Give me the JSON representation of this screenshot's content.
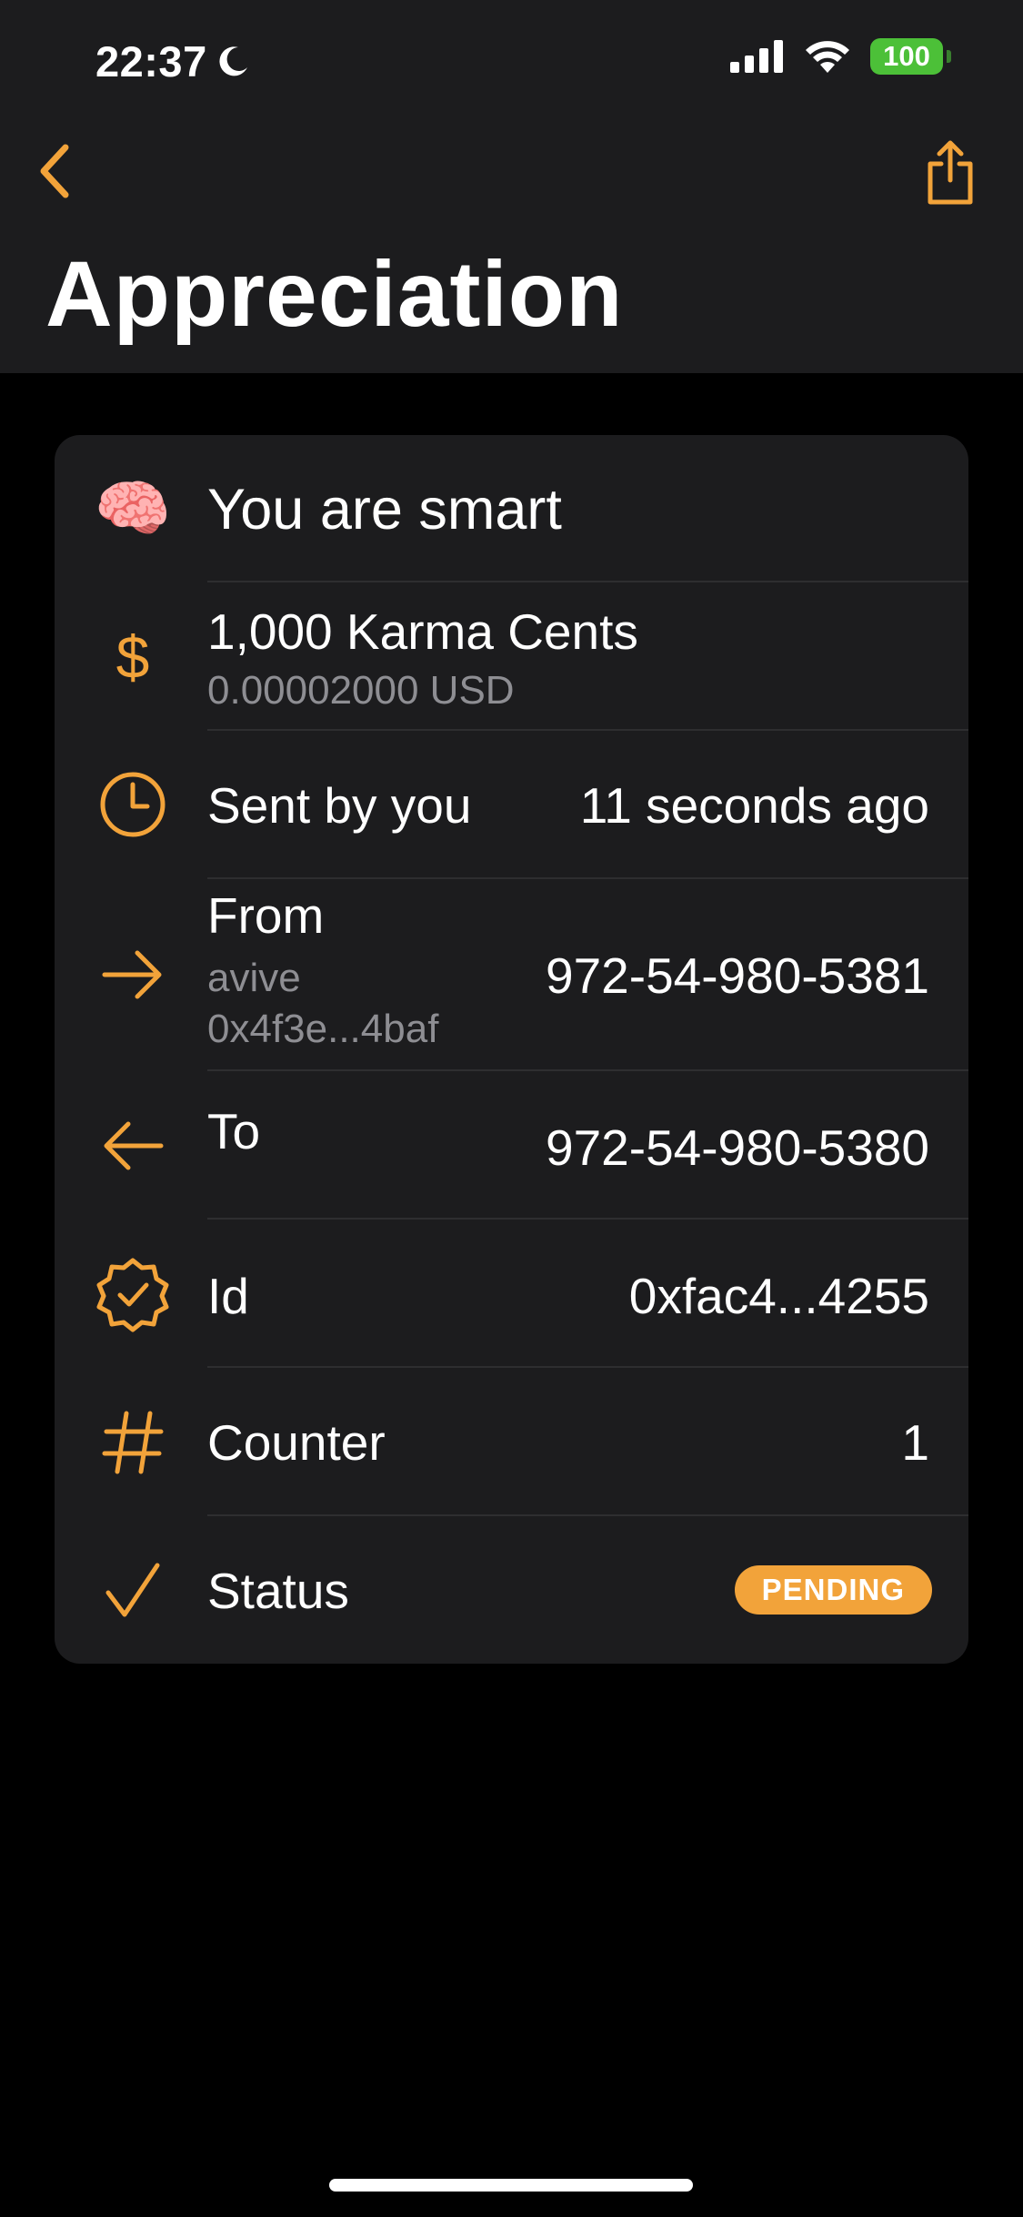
{
  "status_bar": {
    "time": "22:37",
    "battery": "100"
  },
  "nav": {
    "title": "Appreciation"
  },
  "card": {
    "message": {
      "emoji": "🧠",
      "text": "You are smart"
    },
    "amount": {
      "primary": "1,000 Karma Cents",
      "secondary": "0.00002000 USD"
    },
    "sent": {
      "label": "Sent by you",
      "value": "11 seconds ago"
    },
    "from": {
      "label": "From",
      "name": "avive",
      "address": "0x4f3e...4baf",
      "value": "972-54-980-5381"
    },
    "to": {
      "label": "To",
      "value": "972-54-980-5380"
    },
    "id": {
      "label": "Id",
      "value": "0xfac4...4255"
    },
    "counter": {
      "label": "Counter",
      "value": "1"
    },
    "status": {
      "label": "Status",
      "value": "PENDING"
    }
  },
  "colors": {
    "accent": "#f2a33a",
    "battery": "#4cc038",
    "background": "#000000",
    "card": "#1c1c1e"
  }
}
